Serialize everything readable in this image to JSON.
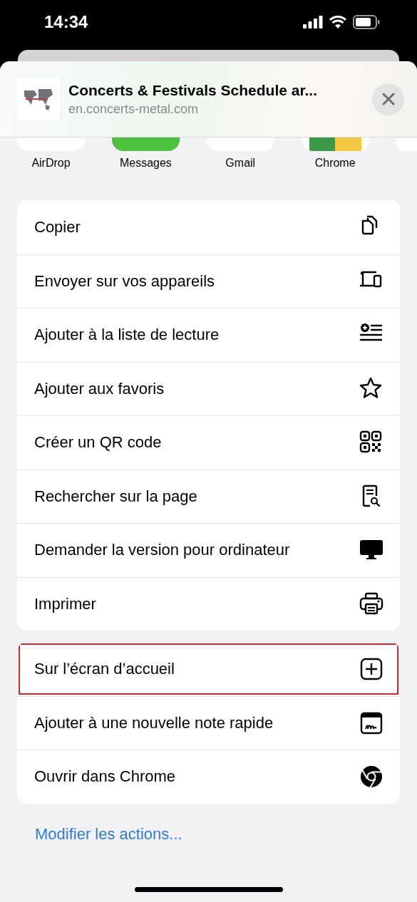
{
  "status_bar": {
    "time": "14:34"
  },
  "share_header": {
    "title": "Concerts & Festivals Schedule ar...",
    "url": "en.concerts-metal.com"
  },
  "apps": [
    {
      "label": "AirDrop"
    },
    {
      "label": "Messages"
    },
    {
      "label": "Gmail"
    },
    {
      "label": "Chrome"
    }
  ],
  "action_groups": [
    {
      "items": [
        {
          "label": "Copier",
          "highlighted": false
        },
        {
          "label": "Envoyer sur vos appareils",
          "highlighted": false
        },
        {
          "label": "Ajouter à la liste de lecture",
          "highlighted": false
        },
        {
          "label": "Ajouter aux favoris",
          "highlighted": false
        },
        {
          "label": "Créer un QR code",
          "highlighted": false
        },
        {
          "label": "Rechercher sur la page",
          "highlighted": false
        },
        {
          "label": "Demander la version pour ordinateur",
          "highlighted": false
        },
        {
          "label": "Imprimer",
          "highlighted": false
        }
      ]
    },
    {
      "items": [
        {
          "label": "Sur l’écran d’accueil",
          "highlighted": true
        },
        {
          "label": "Ajouter à une nouvelle note rapide",
          "highlighted": false
        },
        {
          "label": "Ouvrir dans Chrome",
          "highlighted": false
        }
      ]
    }
  ],
  "edit_actions_link": "Modifier les actions..."
}
